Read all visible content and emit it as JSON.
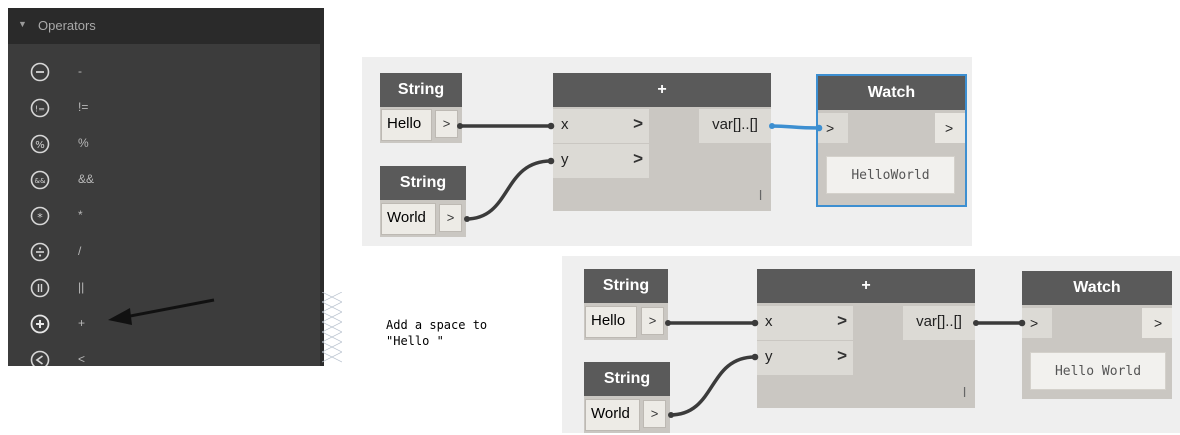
{
  "library": {
    "section_title": "Operators",
    "items": [
      {
        "icon": "minus-icon",
        "label": "-"
      },
      {
        "icon": "not-equal-icon",
        "label": "!="
      },
      {
        "icon": "percent-icon",
        "label": "%"
      },
      {
        "icon": "and-icon",
        "label": "&&"
      },
      {
        "icon": "asterisk-icon",
        "label": "*"
      },
      {
        "icon": "divide-icon",
        "label": "/"
      },
      {
        "icon": "or-icon",
        "label": "||"
      },
      {
        "icon": "plus-icon",
        "label": "+"
      },
      {
        "icon": "less-than-icon",
        "label": "<"
      }
    ]
  },
  "graph1": {
    "string1": {
      "title": "String",
      "value": "Hello",
      "out_arrow": ">"
    },
    "string2": {
      "title": "String",
      "value": "World",
      "out_arrow": ">"
    },
    "add": {
      "title": "+",
      "in_x": "x",
      "in_y": "y",
      "chevron": ">",
      "output": "var[]..[]",
      "lacing": "l"
    },
    "watch": {
      "title": "Watch",
      "in_arrow": ">",
      "out_arrow": ">",
      "display": "HelloWorld"
    },
    "colors": {
      "selected_border": "#3d8fd1",
      "selected_wire": "#3d8fd1"
    }
  },
  "graph2": {
    "string1": {
      "title": "String",
      "value": "Hello",
      "out_arrow": ">"
    },
    "string2": {
      "title": "String",
      "value": "World",
      "out_arrow": ">"
    },
    "add": {
      "title": "+",
      "in_x": "x",
      "in_y": "y",
      "chevron": ">",
      "output": "var[]..[]",
      "lacing": "l"
    },
    "watch": {
      "title": "Watch",
      "in_arrow": ">",
      "out_arrow": ">",
      "display": "Hello World"
    }
  },
  "annotation": {
    "line1": "Add a space to",
    "line2": "\"Hello \""
  }
}
